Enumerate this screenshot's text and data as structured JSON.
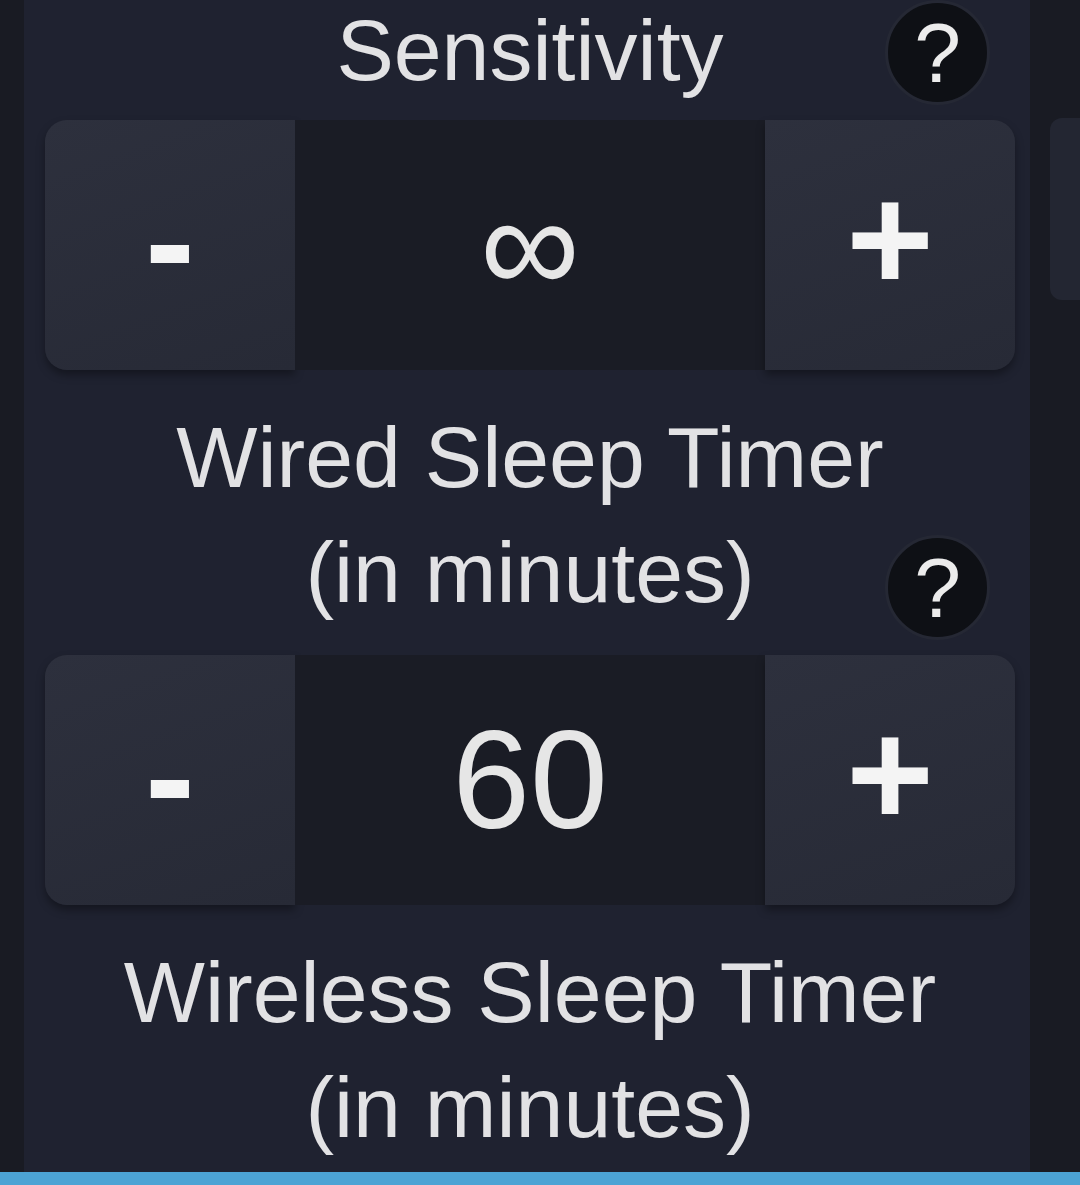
{
  "top_setting": {
    "label": "Sensitivity",
    "help": "?"
  },
  "settings": [
    {
      "decrement": "-",
      "value": "∞",
      "increment": "+",
      "label": "Wired Sleep Timer\n(in minutes)",
      "help": "?"
    },
    {
      "decrement": "-",
      "value": "60",
      "increment": "+",
      "label": "Wireless Sleep Timer\n(in minutes)"
    }
  ]
}
